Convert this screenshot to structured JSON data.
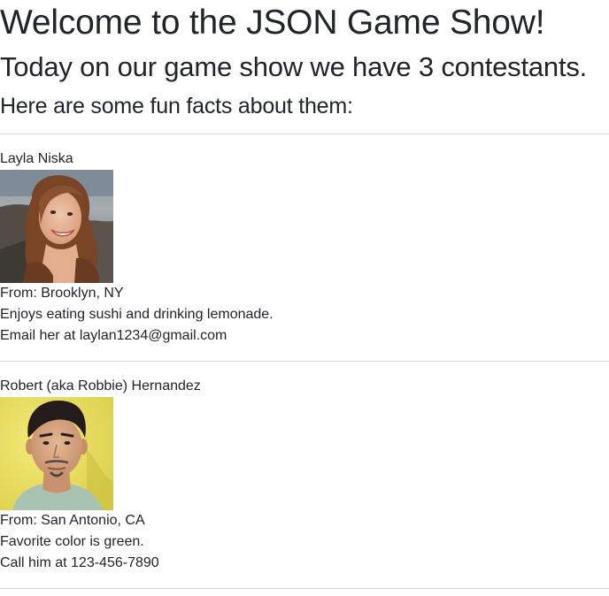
{
  "header": {
    "title": "Welcome to the JSON Game Show!",
    "subtitle": "Today on our game show we have 3 contestants.",
    "intro": "Here are some fun facts about them:"
  },
  "contestants": [
    {
      "name": "Layla Niska",
      "photo": "woman-portrait-photo",
      "from": "From: Brooklyn, NY",
      "fact": "Enjoys eating sushi and drinking lemonade.",
      "contact": "Email her at laylan1234@gmail.com"
    },
    {
      "name": "Robert (aka Robbie) Hernandez",
      "photo": "man-portrait-photo",
      "from": "From: San Antonio, CA",
      "fact": "Favorite color is green.",
      "contact": "Call him at 123-456-7890"
    }
  ]
}
